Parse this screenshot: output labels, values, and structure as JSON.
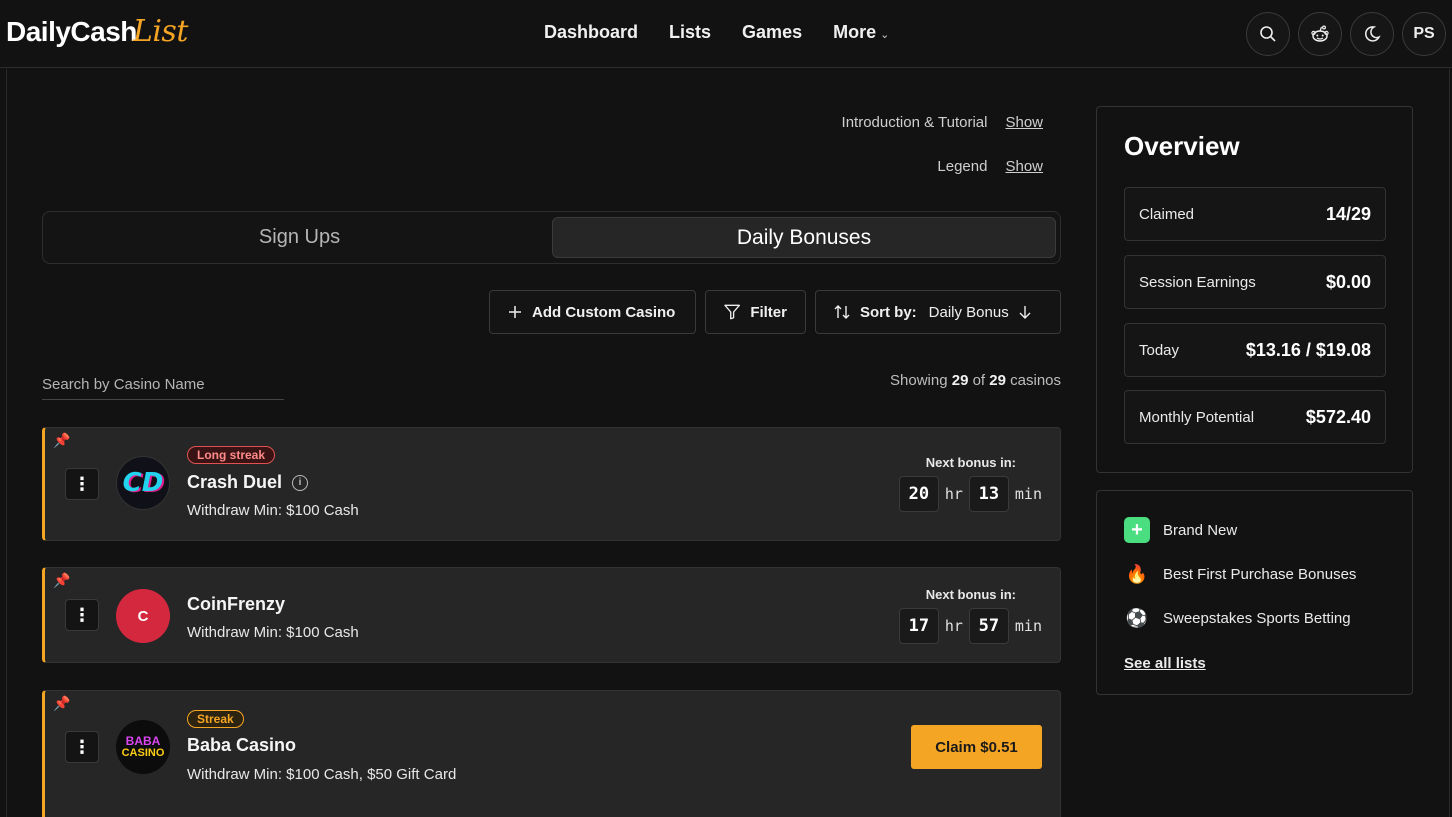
{
  "header": {
    "logo_main": "DailyCash",
    "logo_script": "List",
    "nav": [
      "Dashboard",
      "Lists",
      "Games",
      "More"
    ],
    "avatar_initials": "PS"
  },
  "intro": {
    "tutorial_label": "Introduction & Tutorial",
    "tutorial_link": "Show",
    "legend_label": "Legend",
    "legend_link": "Show"
  },
  "tabs": {
    "signups": "Sign Ups",
    "daily": "Daily Bonuses"
  },
  "toolbar": {
    "add_custom": "Add Custom Casino",
    "filter": "Filter",
    "sort_label": "Sort by:",
    "sort_value": "Daily Bonus"
  },
  "search": {
    "placeholder": "Search by Casino Name"
  },
  "showing": {
    "prefix": "Showing",
    "count": "29",
    "of": "of",
    "total": "29",
    "suffix": "casinos"
  },
  "casinos": [
    {
      "badge": "Long streak",
      "name": "Crash Duel",
      "withdraw": "Withdraw Min: $100 Cash",
      "logo_text": "CD",
      "next_label": "Next bonus in:",
      "hours": "20",
      "hr_unit": "hr",
      "mins": "13",
      "min_unit": "min"
    },
    {
      "badge": "",
      "name": "CoinFrenzy",
      "withdraw": "Withdraw Min: $100 Cash",
      "logo_text": "C",
      "next_label": "Next bonus in:",
      "hours": "17",
      "hr_unit": "hr",
      "mins": "57",
      "min_unit": "min"
    },
    {
      "badge": "Streak",
      "name": "Baba Casino",
      "withdraw": "Withdraw Min: $100 Cash, $50 Gift Card",
      "logo_text_top": "BABA",
      "logo_text_bottom": "CASINO",
      "claim": "Claim $0.51"
    }
  ],
  "overview": {
    "title": "Overview",
    "stats": [
      {
        "label": "Claimed",
        "value": "14/29"
      },
      {
        "label": "Session Earnings",
        "value": "$0.00"
      },
      {
        "label": "Today",
        "value": "$13.16 / $19.08"
      },
      {
        "label": "Monthly Potential",
        "value": "$572.40"
      }
    ]
  },
  "lists": {
    "items": [
      {
        "label": "Brand New",
        "icon": "plus-square-icon"
      },
      {
        "label": "Best First Purchase Bonuses",
        "icon": "campfire-icon"
      },
      {
        "label": "Sweepstakes Sports Betting",
        "icon": "soccer-ball-icon"
      }
    ],
    "see_all": "See all lists"
  },
  "colors": {
    "accent": "#f5a524",
    "background": "#121212",
    "card": "#262626",
    "coinfrenzy": "#d4283e"
  }
}
